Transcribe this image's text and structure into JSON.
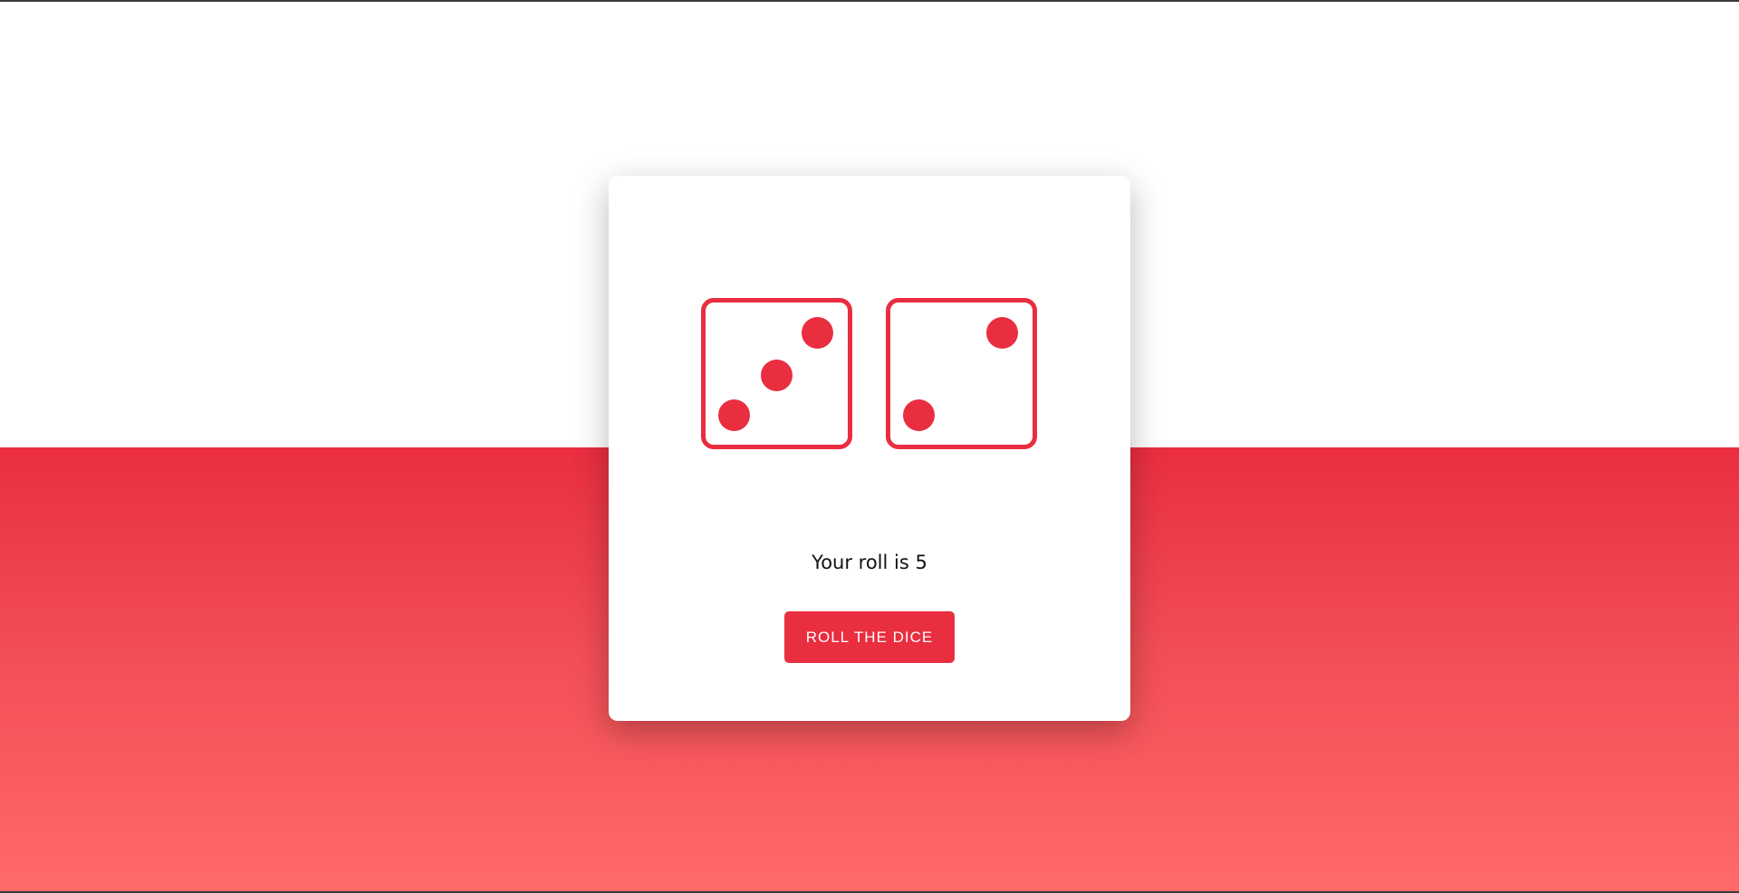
{
  "dice": {
    "left_value": 3,
    "right_value": 2,
    "icon_left": "die-three-icon",
    "icon_right": "die-two-icon"
  },
  "result": {
    "text": "Your roll is 5"
  },
  "button": {
    "label": "ROLL THE DICE"
  },
  "colors": {
    "accent": "#e92e40",
    "gradient_end": "#ff6a68",
    "text": "#111111"
  }
}
